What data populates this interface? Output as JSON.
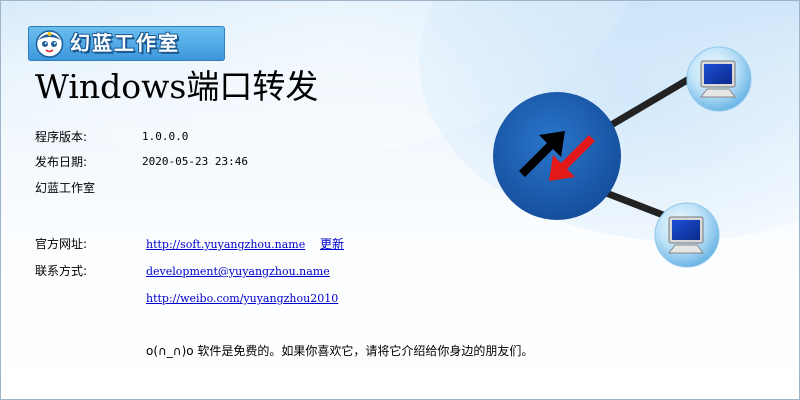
{
  "logo": {
    "text": "幻蓝工作室"
  },
  "title": "Windows端口转发",
  "info": {
    "version_label": "程序版本:",
    "version_value": "1.0.0.0",
    "date_label": "发布日期:",
    "date_value": "2020-05-23 23:46",
    "studio": "幻蓝工作室"
  },
  "links": {
    "website_label": "官方网址:",
    "website_url": "http://soft.yuyangzhou.name",
    "update_label": "更新",
    "contact_label": "联系方式:",
    "email": "development@yuyangzhou.name",
    "weibo": "http://weibo.com/yuyangzhou2010"
  },
  "note": "o(∩_∩)o 软件是免费的。如果你喜欢它，请将它介绍给你身边的朋友们。",
  "colors": {
    "hub": "#1a5fb5",
    "arrow_black": "#000000",
    "arrow_red": "#e31919",
    "connector": "#222222",
    "link": "#0000cc"
  },
  "icons": [
    "hub-transfer-icon",
    "computer-monitor-icon",
    "computer-monitor-icon"
  ]
}
